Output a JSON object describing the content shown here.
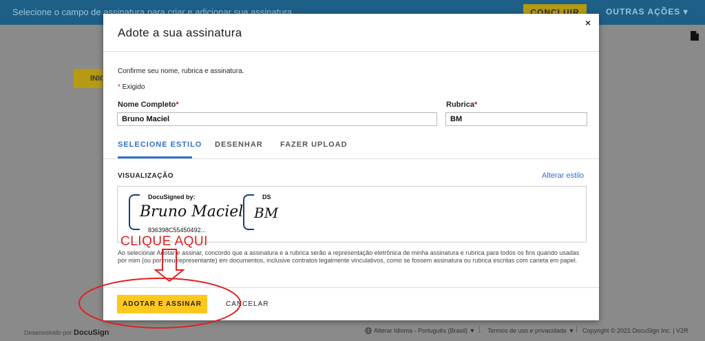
{
  "topbar": {
    "message": "Selecione o campo de assinatura para criar e adicionar sua assinatura",
    "concluir": "CONCLUIR",
    "outras_acoes": "OUTRAS AÇÕES ▾"
  },
  "background": {
    "iniciar_partial": "INIC"
  },
  "modal": {
    "title": "Adote a sua assinatura",
    "close": "×",
    "confirm_text": "Confirme seu nome, rubrica e assinatura.",
    "required_star": "*",
    "required_text": " Exigido",
    "full_name_label": "Nome Completo",
    "full_name_value": "Bruno Maciel",
    "initials_label": "Rubrica",
    "initials_value": "BM",
    "tabs": [
      {
        "label": "SELECIONE ESTILO",
        "active": true
      },
      {
        "label": "DESENHAR",
        "active": false
      },
      {
        "label": "FAZER UPLOAD",
        "active": false
      }
    ],
    "preview_label": "VISUALIZAÇÃO",
    "change_style": "Alterar estilo",
    "signature": {
      "header": "DocuSigned by:",
      "script": "Bruno Maciel",
      "hash": "836398C55450492..."
    },
    "initials_preview": {
      "header": "DS",
      "script": "BM"
    },
    "disclaimer": "Ao selecionar Adotar e assinar, concordo que a assinatura e a rubrica serão a representação eletrônica de minha assinatura e rubrica para todos os fins quando usadas por mim (ou por meu representante) em documentos, inclusive contratos legalmente vinculativos, como se fossem assinatura ou rubrica escritas com caneta em papel.",
    "adopt_button": "ADOTAR E ASSINAR",
    "cancel_button": "CANCELAR"
  },
  "annotation": {
    "text": "CLIQUE AQUI",
    "color": "#e02020"
  },
  "footer": {
    "powered_prefix": "Desenvolvido por ",
    "powered_brand": "DocuSign",
    "language": "Alterar Idioma - Português (Brasil)  ▼",
    "terms": "Termos de uso e privacidade  ▼",
    "copyright": "Copyright © 2021 DocuSign Inc. | V2R"
  },
  "colors": {
    "accent": "#2f6fcb",
    "button": "#ffc820",
    "topbar": "#1d5f86"
  }
}
